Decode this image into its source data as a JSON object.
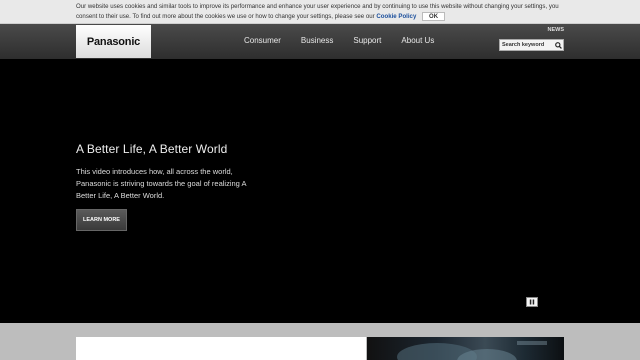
{
  "cookie_bar": {
    "text": "Our website uses cookies and similar tools to improve its performance and enhance your user experience and by continuing to use this website without changing your settings, you consent to their use. To find out more about the cookies we use or how to change your settings, please see our",
    "link_label": "Cookie Policy",
    "ok_label": "OK"
  },
  "header": {
    "logo": "Panasonic",
    "nav": [
      "Consumer",
      "Business",
      "Support",
      "About Us"
    ],
    "news_label": "NEWS",
    "search_placeholder": "Search keyword"
  },
  "hero": {
    "title": "A Better Life, A Better World",
    "description": "This video introduces how, all across the world, Panasonic is striving towards the goal of realizing A Better Life, A Better World.",
    "cta_label": "LEARN MORE"
  },
  "colors": {
    "header_bg": "#3c3c3c",
    "hero_bg": "#000000",
    "link": "#1b4f9c"
  }
}
